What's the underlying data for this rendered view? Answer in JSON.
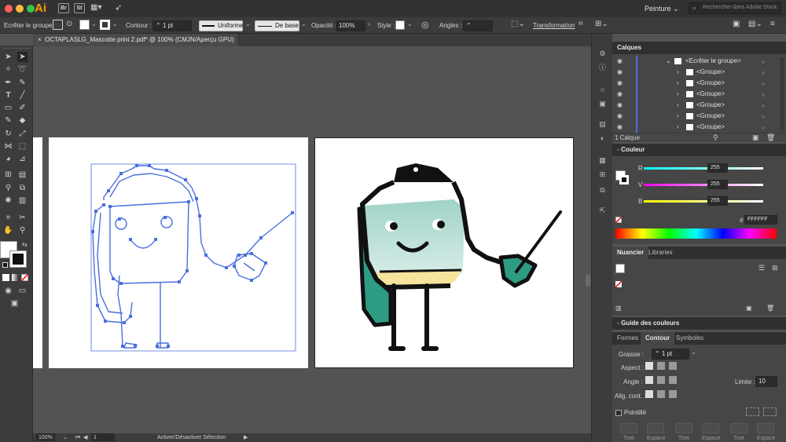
{
  "app": {
    "logo": "Ai",
    "badges": [
      "Br",
      "St"
    ],
    "workspace": "Peinture",
    "search_placeholder": "Rechercher dans Adobe Stock"
  },
  "options_bar": {
    "group_label": "Ecrêter le groupe",
    "stroke_label": "Contour :",
    "stroke_value": "1 pt",
    "profile": "Uniforme",
    "brush": "De base",
    "opacity_label": "Opacité :",
    "opacity_value": "100%",
    "style_label": "Style :",
    "corners_label": "Angles :",
    "transform_label": "Transformation"
  },
  "document": {
    "tab_title": "OCTAPLASLG_Mascotte print 2.pdf* @ 100% (CMJN/Aperçu GPU)"
  },
  "status": {
    "zoom": "100%",
    "page": "1",
    "tool_hint": "Activer/Désactiver Sélection"
  },
  "layers_panel": {
    "title": "Calques",
    "parent": "<Ecrêter le groupe>",
    "rows": [
      "<Groupe>",
      "<Groupe>",
      "<Groupe>",
      "<Groupe>",
      "<Groupe>",
      "<Groupe>"
    ],
    "count": "1 Calque"
  },
  "color_panel": {
    "title": "Couleur",
    "channels": [
      {
        "label": "R",
        "value": "255",
        "color": "#00e5e5"
      },
      {
        "label": "V",
        "value": "255",
        "color": "#e51ee5"
      },
      {
        "label": "B",
        "value": "255",
        "color": "#e5e500"
      }
    ],
    "hex_label": "#",
    "hex_value": "FFFFFF"
  },
  "swatches_panel": {
    "tabs": [
      "Nuancier",
      "Libraries"
    ]
  },
  "color_guide": {
    "title": "Guide des couleurs"
  },
  "stroke_panel": {
    "tabs": [
      "Formes",
      "Contour",
      "Symboles"
    ],
    "weight_label": "Graisse :",
    "weight_value": "1 pt",
    "cap_label": "Aspect :",
    "corner_label": "Angle :",
    "limit_label": "Limite :",
    "limit_value": "10",
    "align_label": "Alig. cont. :",
    "dashed_label": "Pointillé",
    "dash_labels": [
      "Tiret",
      "Espace",
      "Tiret",
      "Espace",
      "Tiret",
      "Espace"
    ]
  },
  "colors": {
    "accent_orange": "#ff9a00",
    "selection_blue": "#4a6fe0",
    "mascot_teal": "#2e9b83",
    "mascot_glass": "#b5ddd3",
    "mascot_liquid": "#f5e49c"
  }
}
